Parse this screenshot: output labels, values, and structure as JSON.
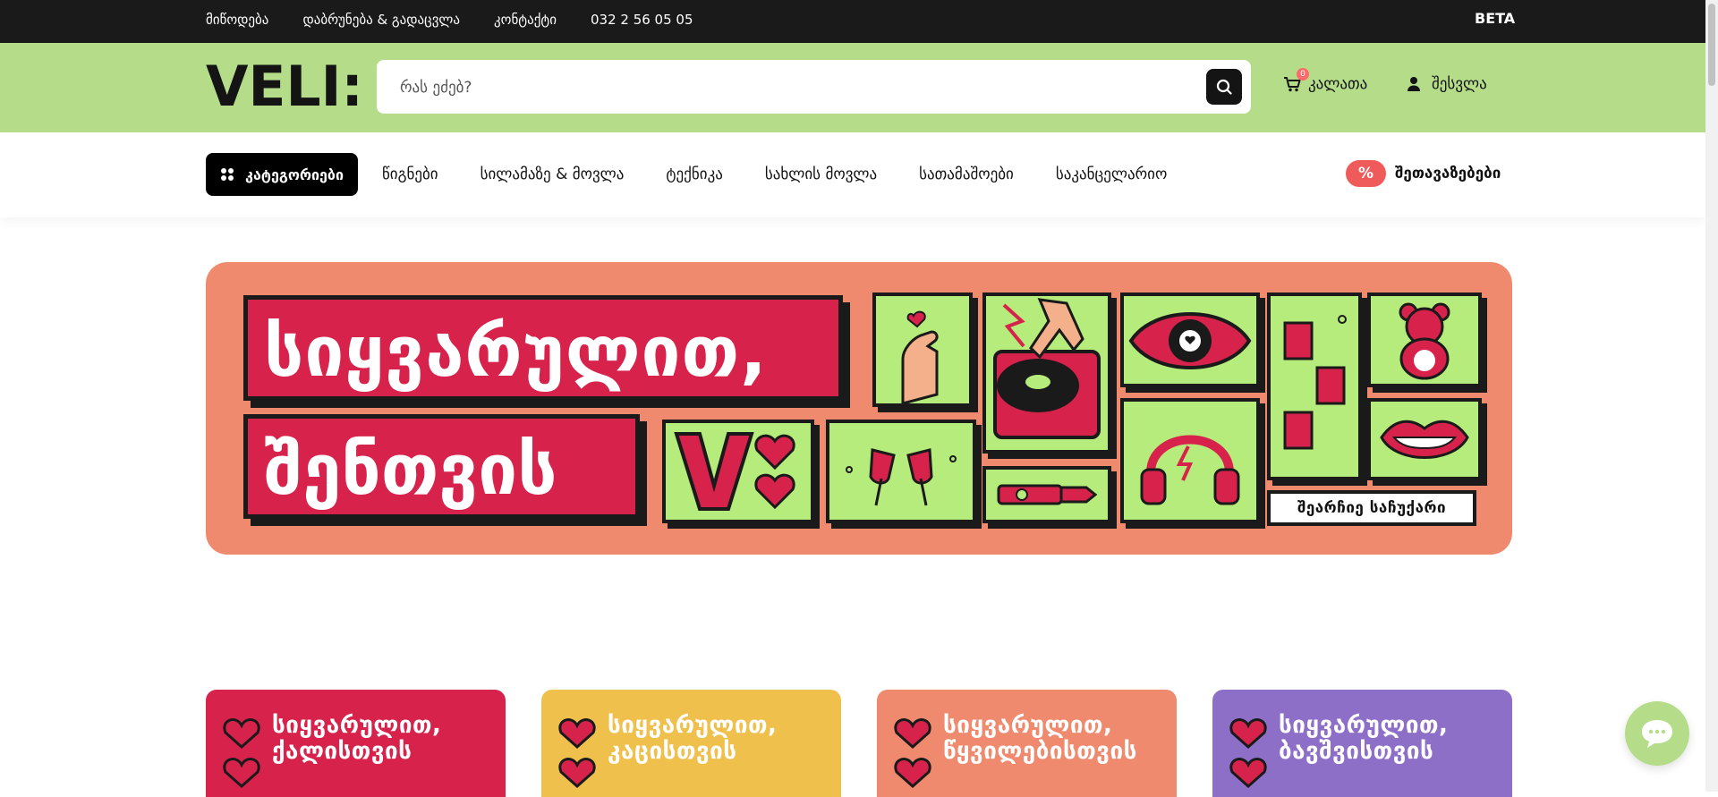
{
  "topbar": {
    "links": [
      "მიწოდება",
      "დაბრუნება & გადაცვლა",
      "კონტაქტი",
      "032 2 56 05 05"
    ],
    "beta": "BETA"
  },
  "header": {
    "logo_text": "VELI:",
    "search_placeholder": "რას ეძებ?",
    "cart_count": "0",
    "cart_label": "კალათა",
    "login_label": "შესვლა",
    "brand_color": "#b5dd89"
  },
  "nav": {
    "categories_label": "კატეგორიები",
    "items": [
      "წიგნები",
      "სილამაზე & მოვლა",
      "ტექნიკა",
      "სახლის მოვლა",
      "სათამაშოები",
      "საკანცელარიო"
    ],
    "deals_badge": "%",
    "deals_label": "შეთავაზებები"
  },
  "hero": {
    "title_line1": "სიყვარულით,",
    "title_line2": "შენთვის",
    "cta": "შეარჩიე საჩუქარი",
    "background": "#ef8a6f",
    "accent": "#d7234b",
    "tile_color": "#b5ec7b"
  },
  "cards": [
    {
      "title": "სიყვარულით,\nქალისთვის",
      "color": "#d7234b"
    },
    {
      "title": "სიყვარულით,\nკაცისთვის",
      "color": "#f0c04d"
    },
    {
      "title": "სიყვარულით,\nწყვილებისთვის",
      "color": "#ef8a6f"
    },
    {
      "title": "სიყვარულით,\nბავშვისთვის",
      "color": "#8e6fc8"
    }
  ],
  "icons": [
    "search-icon",
    "cart-icon",
    "user-icon",
    "grid-icon",
    "chat-icon",
    "heart-icon"
  ]
}
